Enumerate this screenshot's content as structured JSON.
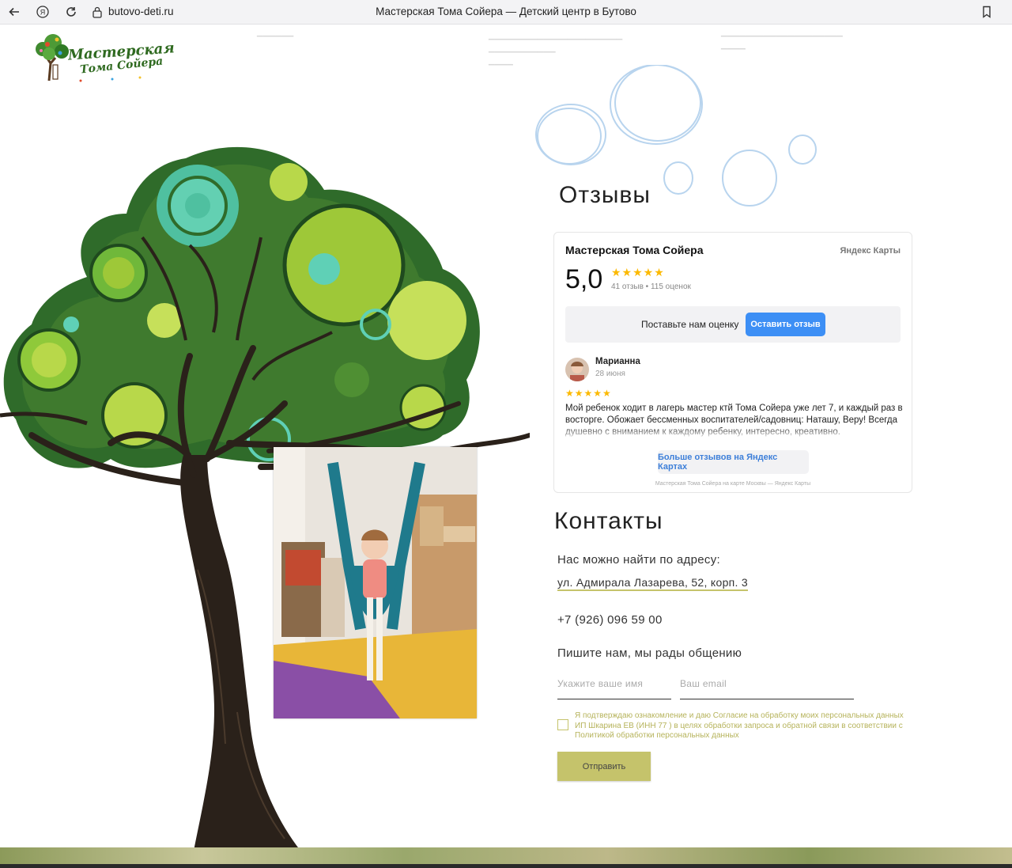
{
  "browser": {
    "url": "butovo-deti.ru",
    "tab_title": "Мастерская Тома Сойера — Детский центр в Бутово"
  },
  "logo": {
    "line1": "Мастерская",
    "line2": "Тома Сойера"
  },
  "reviews": {
    "title": "Отзывы",
    "org_name": "Мастерская Тома Сойера",
    "provider": "Яндекс Карты",
    "rating": "5,0",
    "stars": "★★★★★",
    "meta": "41 отзыв • 115 оценок",
    "rate_prompt": "Поставьте нам оценку",
    "rate_button": "Оставить отзыв",
    "review": {
      "author": "Марианна",
      "date": "28 июня",
      "stars": "★★★★★",
      "text": "Мой ребенок ходит в лагерь мастер ктй Тома Сойера уже лет 7, и каждый раз в восторге. Обожает бессменных воспитателей/садовниц: Наташу, Веру! Всегда душевно с вниманием к каждому ребенку, интересно, креативно."
    },
    "more_button": "Больше отзывов на Яндекс Картах",
    "footer": "Мастерская Тома Сойера на карте Москвы — Яндекс Карты"
  },
  "contacts": {
    "title": "Контакты",
    "address_label": "Нас можно найти по адресу:",
    "address": "ул. Адмирала Лазарева, 52, корп. 3",
    "phone": "+7 (926) 096 59 00",
    "write_us": "Пишите нам, мы рады общению",
    "name_placeholder": "Укажите ваше имя",
    "email_placeholder": "Ваш email",
    "consent": "Я подтверждаю ознакомление и даю Согласие на обработку моих персональных данных ИП Шкарина ЕВ (ИНН 77 ) в целях обработки запроса и обратной связи в соответствии с Политикой обработки персональных данных",
    "submit": "Отправить"
  },
  "colors": {
    "accent": "#c5c36b",
    "yandex_blue": "#3d8ff5",
    "star": "#fcb900",
    "tree_green": "#3f7a2e"
  }
}
